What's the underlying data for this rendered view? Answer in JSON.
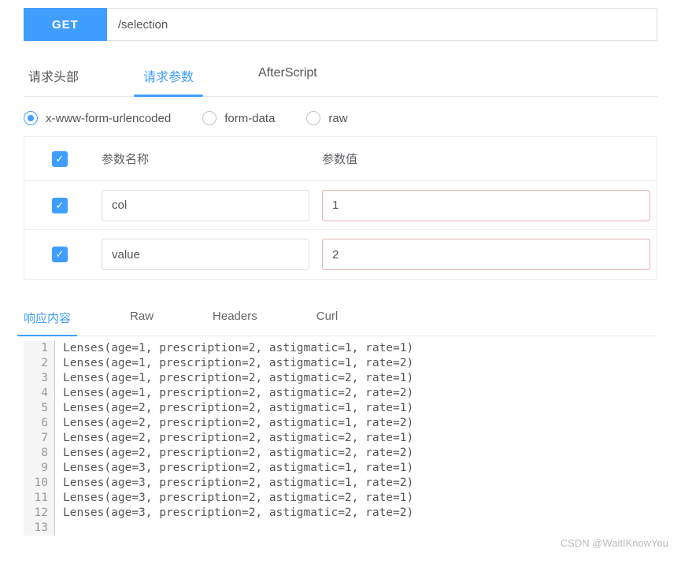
{
  "method": "GET",
  "url": "/selection",
  "topTabs": {
    "headers": "请求头部",
    "params": "请求参数",
    "afterScript": "AfterScript",
    "active": "params"
  },
  "bodyType": {
    "urlencoded": "x-www-form-urlencoded",
    "formData": "form-data",
    "raw": "raw",
    "selected": "urlencoded"
  },
  "paramsHeader": {
    "name": "参数名称",
    "value": "参数值"
  },
  "params": [
    {
      "checked": true,
      "name": "col",
      "value": "1"
    },
    {
      "checked": true,
      "name": "value",
      "value": "2"
    }
  ],
  "respTabs": {
    "content": "响应内容",
    "raw": "Raw",
    "headers": "Headers",
    "curl": "Curl",
    "active": "content"
  },
  "responseLines": [
    "Lenses(age=1, prescription=2, astigmatic=1, rate=1)",
    "Lenses(age=1, prescription=2, astigmatic=1, rate=2)",
    "Lenses(age=1, prescription=2, astigmatic=2, rate=1)",
    "Lenses(age=1, prescription=2, astigmatic=2, rate=2)",
    "Lenses(age=2, prescription=2, astigmatic=1, rate=1)",
    "Lenses(age=2, prescription=2, astigmatic=1, rate=2)",
    "Lenses(age=2, prescription=2, astigmatic=2, rate=1)",
    "Lenses(age=2, prescription=2, astigmatic=2, rate=2)",
    "Lenses(age=3, prescription=2, astigmatic=1, rate=1)",
    "Lenses(age=3, prescription=2, astigmatic=1, rate=2)",
    "Lenses(age=3, prescription=2, astigmatic=2, rate=1)",
    "Lenses(age=3, prescription=2, astigmatic=2, rate=2)",
    ""
  ],
  "watermark": "CSDN @WaitIKnowYou"
}
